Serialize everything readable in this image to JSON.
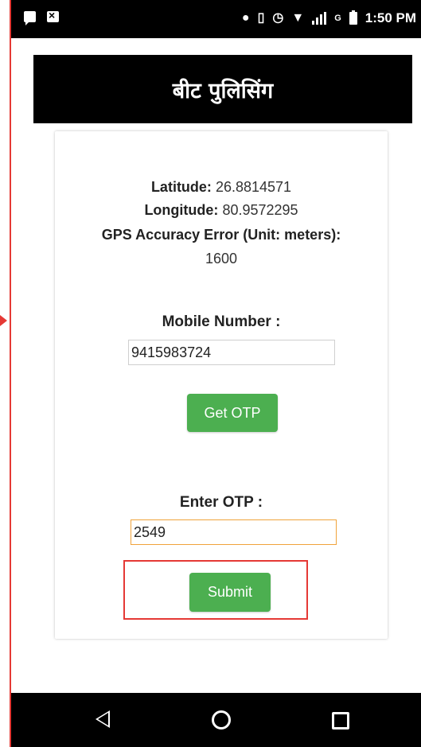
{
  "statusbar": {
    "time": "1:50 PM",
    "icons_left": [
      "message-icon",
      "notification-x-icon"
    ],
    "icons_right": [
      "location-pin-icon",
      "vibrate-icon",
      "alarm-icon",
      "wifi-icon",
      "signal-icon",
      "battery-icon"
    ],
    "network_label": "G"
  },
  "header": {
    "title": "बीट पुलिसिंग"
  },
  "location": {
    "latitude_label": "Latitude:",
    "latitude_value": "26.8814571",
    "longitude_label": "Longitude:",
    "longitude_value": "80.9572295",
    "accuracy_label": "GPS Accuracy Error (Unit: meters):",
    "accuracy_value": "1600"
  },
  "mobile": {
    "label": "Mobile Number :",
    "value": "9415983724",
    "get_otp_label": "Get OTP"
  },
  "otp": {
    "label": "Enter OTP :",
    "value": "2549",
    "submit_label": "Submit"
  },
  "colors": {
    "button_green": "#4caf50",
    "header_black": "#000000",
    "highlight_red": "#e53935",
    "focus_orange": "#f0a33b"
  },
  "navbar": {
    "icons": [
      "back-icon",
      "home-icon",
      "recent-apps-icon"
    ]
  }
}
